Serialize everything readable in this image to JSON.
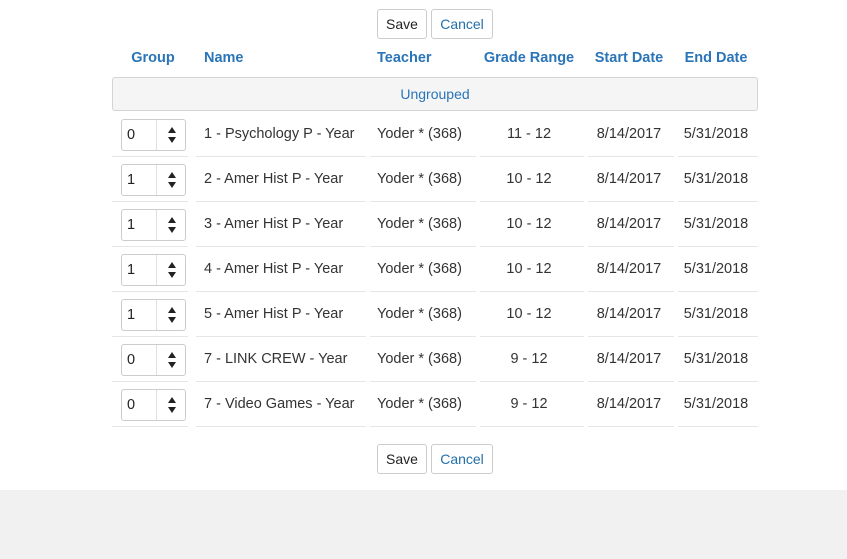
{
  "buttons": {
    "save_label": "Save",
    "cancel_label": "Cancel"
  },
  "columns": {
    "group": "Group",
    "name": "Name",
    "teacher": "Teacher",
    "grade_range": "Grade Range",
    "start_date": "Start Date",
    "end_date": "End Date"
  },
  "group_header": "Ungrouped",
  "rows": [
    {
      "group": "0",
      "name": "1 - Psychology P - Year",
      "teacher": "Yoder * (368)",
      "grade_range": "11 - 12",
      "start_date": "8/14/2017",
      "end_date": "5/31/2018"
    },
    {
      "group": "1",
      "name": "2 - Amer Hist P - Year",
      "teacher": "Yoder * (368)",
      "grade_range": "10 - 12",
      "start_date": "8/14/2017",
      "end_date": "5/31/2018"
    },
    {
      "group": "1",
      "name": "3 - Amer Hist P - Year",
      "teacher": "Yoder * (368)",
      "grade_range": "10 - 12",
      "start_date": "8/14/2017",
      "end_date": "5/31/2018"
    },
    {
      "group": "1",
      "name": "4 - Amer Hist P - Year",
      "teacher": "Yoder * (368)",
      "grade_range": "10 - 12",
      "start_date": "8/14/2017",
      "end_date": "5/31/2018"
    },
    {
      "group": "1",
      "name": "5 - Amer Hist P - Year",
      "teacher": "Yoder * (368)",
      "grade_range": "10 - 12",
      "start_date": "8/14/2017",
      "end_date": "5/31/2018"
    },
    {
      "group": "0",
      "name": "7 - LINK CREW - Year",
      "teacher": "Yoder * (368)",
      "grade_range": "9 - 12",
      "start_date": "8/14/2017",
      "end_date": "5/31/2018"
    },
    {
      "group": "0",
      "name": "7 - Video Games - Year",
      "teacher": "Yoder * (368)",
      "grade_range": "9 - 12",
      "start_date": "8/14/2017",
      "end_date": "5/31/2018"
    }
  ]
}
